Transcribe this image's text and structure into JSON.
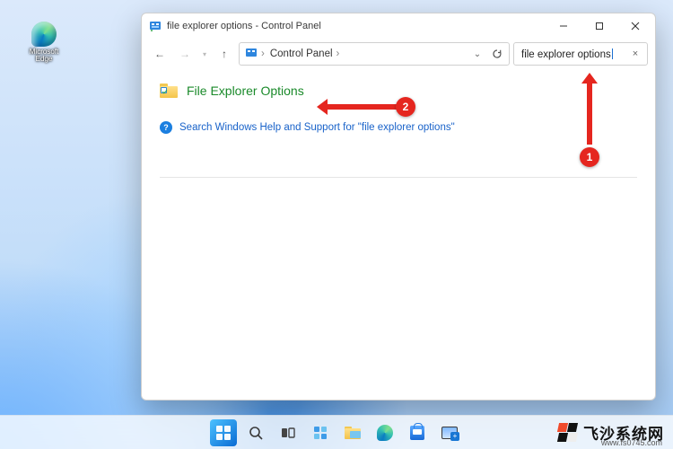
{
  "desktop": {
    "edge_label": "Microsoft\nEdge"
  },
  "window": {
    "title": "file explorer options - Control Panel",
    "nav": {
      "back": "←",
      "forward": "→",
      "up": "↑"
    },
    "address": {
      "root": "Control Panel",
      "drop_tip": "▾",
      "refresh_tip": "⟳"
    },
    "search": {
      "query": "file explorer options",
      "clear": "×"
    },
    "result": {
      "title": "File Explorer Options"
    },
    "help": {
      "text": "Search Windows Help and Support for \"file explorer options\""
    },
    "controls": {
      "min": "—",
      "max": "▢",
      "close": "✕"
    }
  },
  "annotations": {
    "badge1": "1",
    "badge2": "2"
  },
  "watermark": {
    "text": "飞沙系统网",
    "url": "www.fs0745.com"
  },
  "taskbar": {
    "items": [
      "start",
      "search",
      "taskview",
      "widgets",
      "explorer",
      "edge",
      "store",
      "snip"
    ]
  }
}
